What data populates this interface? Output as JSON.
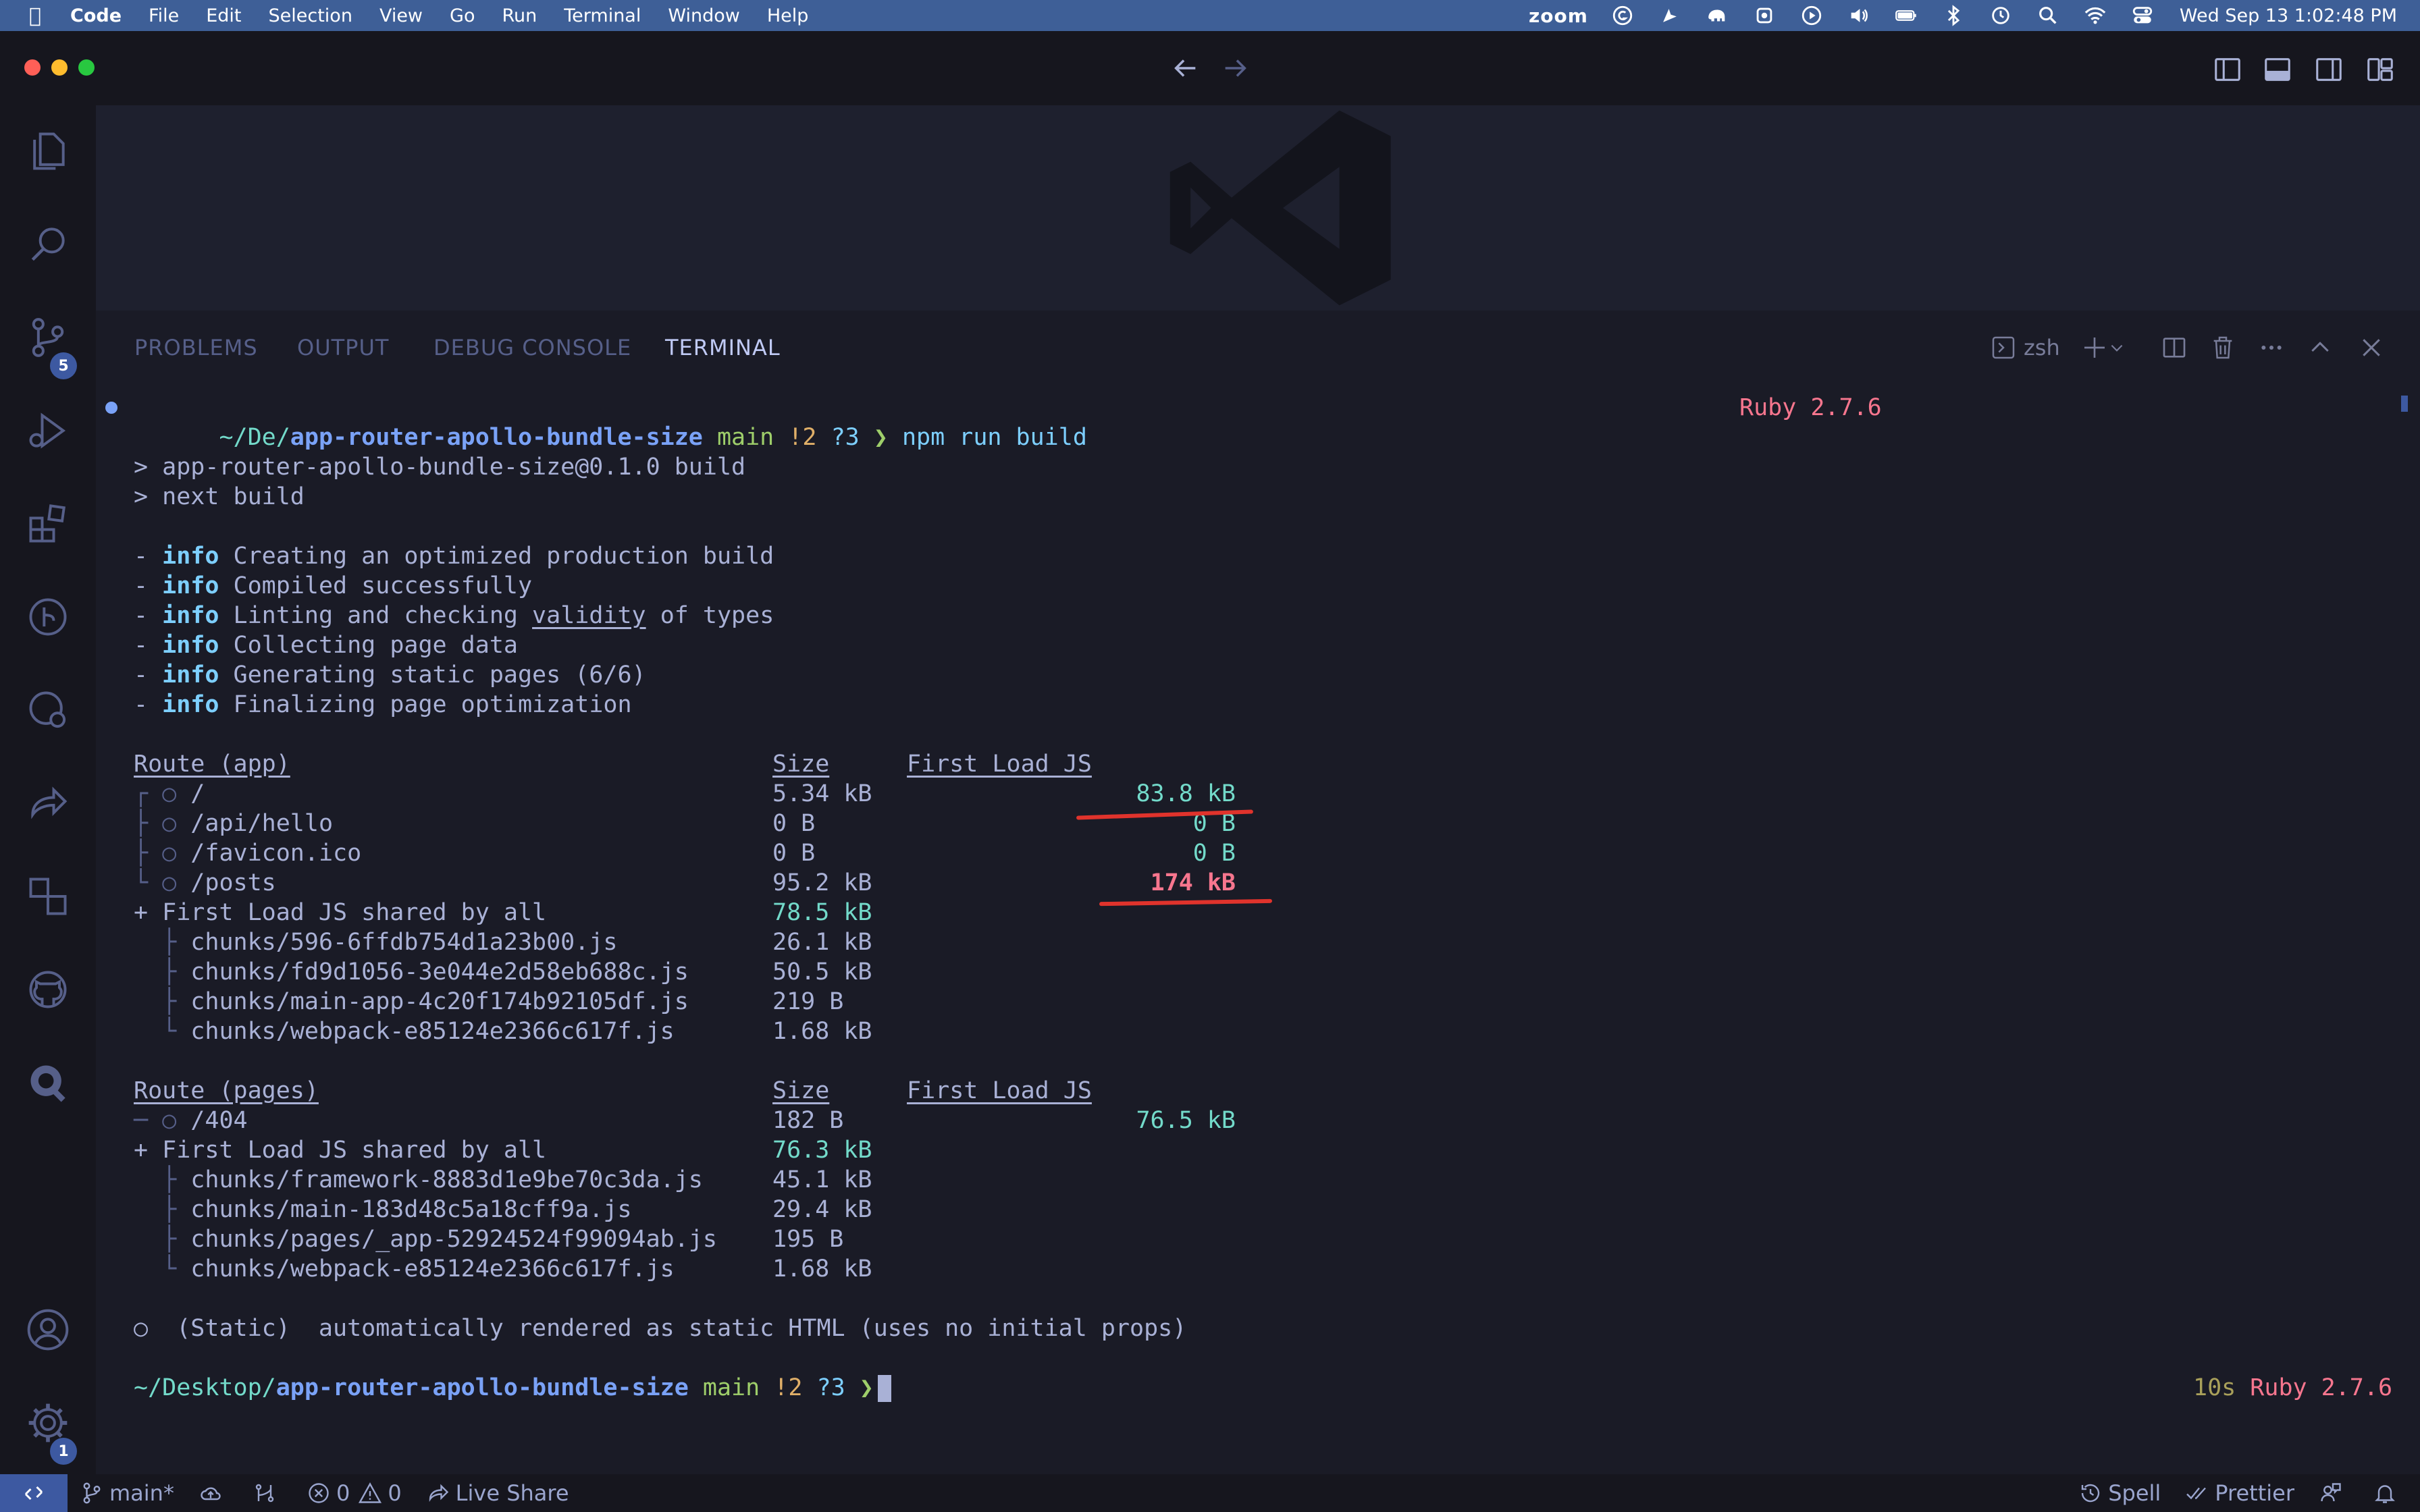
{
  "menubar": {
    "app_name": "Code",
    "items": [
      "File",
      "Edit",
      "Selection",
      "View",
      "Go",
      "Run",
      "Terminal",
      "Window",
      "Help"
    ],
    "zoom_label": "zoom",
    "clock": "Wed Sep 13  1:02:48 PM"
  },
  "activity": {
    "scm_badge": "5",
    "settings_badge": "1"
  },
  "panel": {
    "tabs": [
      "PROBLEMS",
      "OUTPUT",
      "DEBUG CONSOLE",
      "TERMINAL"
    ],
    "active_tab": "TERMINAL",
    "shell_name": "zsh"
  },
  "terminal": {
    "prompt1": {
      "path_prefix": "~/De/",
      "path_dir": "app-router-apollo-bundle-size",
      "branch": "main",
      "status_mod": "!2",
      "status_new": "?3",
      "arrow": "❯",
      "command": "npm run build",
      "right": "Ruby 2.7.6"
    },
    "npm_lines": [
      "> app-router-apollo-bundle-size@0.1.0 build",
      "> next build"
    ],
    "info_lines": [
      {
        "dash": "- ",
        "tag": "info",
        "text": "Creating an optimized production build"
      },
      {
        "dash": "- ",
        "tag": "info",
        "text": "Compiled successfully"
      },
      {
        "dash": "- ",
        "tag": "info",
        "text_pre": "Linting and checking ",
        "text_ul": "validity",
        "text_post": " of types"
      },
      {
        "dash": "- ",
        "tag": "info",
        "text": "Collecting page data"
      },
      {
        "dash": "- ",
        "tag": "info",
        "text": "Generating static pages (6/6)"
      },
      {
        "dash": "- ",
        "tag": "info",
        "text": "Finalizing page optimization"
      }
    ],
    "app_table": {
      "header": {
        "route": "Route (app)",
        "size": "Size",
        "first": "First Load JS"
      },
      "rows": [
        {
          "tree": "┌ ○ ",
          "route": "/",
          "size": "5.34 kB",
          "first": "83.8 kB"
        },
        {
          "tree": "├ ○ ",
          "route": "/api/hello",
          "size": "0 B",
          "first": "0 B"
        },
        {
          "tree": "├ ○ ",
          "route": "/favicon.ico",
          "size": "0 B",
          "first": "0 B"
        },
        {
          "tree": "└ ○ ",
          "route": "/posts",
          "size": "95.2 kB",
          "first": "174 kB"
        }
      ],
      "shared": {
        "label": "+ First Load JS shared by all",
        "size": "78.5 kB"
      },
      "chunks": [
        {
          "tree": "  ├ ",
          "name": "chunks/596-6ffdb754d1a23b00.js",
          "size": "26.1 kB"
        },
        {
          "tree": "  ├ ",
          "name": "chunks/fd9d1056-3e044e2d58eb688c.js",
          "size": "50.5 kB"
        },
        {
          "tree": "  ├ ",
          "name": "chunks/main-app-4c20f174b92105df.js",
          "size": "219 B"
        },
        {
          "tree": "  └ ",
          "name": "chunks/webpack-e85124e2366c617f.js",
          "size": "1.68 kB"
        }
      ]
    },
    "pages_table": {
      "header": {
        "route": "Route (pages)",
        "size": "Size",
        "first": "First Load JS"
      },
      "rows": [
        {
          "tree": "─ ○ ",
          "route": "/404",
          "size": "182 B",
          "first": "76.5 kB"
        }
      ],
      "shared": {
        "label": "+ First Load JS shared by all",
        "size": "76.3 kB"
      },
      "chunks": [
        {
          "tree": "  ├ ",
          "name": "chunks/framework-8883d1e9be70c3da.js",
          "size": "45.1 kB"
        },
        {
          "tree": "  ├ ",
          "name": "chunks/main-183d48c5a18cff9a.js",
          "size": "29.4 kB"
        },
        {
          "tree": "  ├ ",
          "name": "chunks/pages/_app-52924524f99094ab.js",
          "size": "195 B"
        },
        {
          "tree": "  └ ",
          "name": "chunks/webpack-e85124e2366c617f.js",
          "size": "1.68 kB"
        }
      ]
    },
    "legend": "○  (Static)  automatically rendered as static HTML (uses no initial props)",
    "prompt2": {
      "path_prefix": "~/Desktop/",
      "path_dir": "app-router-apollo-bundle-size",
      "branch": "main",
      "status_mod": "!2",
      "status_new": "?3",
      "arrow": "❯",
      "duration": "10s",
      "right": "Ruby 2.7.6"
    }
  },
  "statusbar": {
    "branch": "main*",
    "errors": "0",
    "warnings": "0",
    "live_share": "Live Share",
    "spell": "Spell",
    "prettier": "Prettier"
  },
  "colors": {
    "menubar_bg": "#3e5f97",
    "terminal_bg": "#1a1b26",
    "accent": "#3d59a1",
    "highlight_red": "#f7768e",
    "annotation_red": "#e0332c"
  }
}
